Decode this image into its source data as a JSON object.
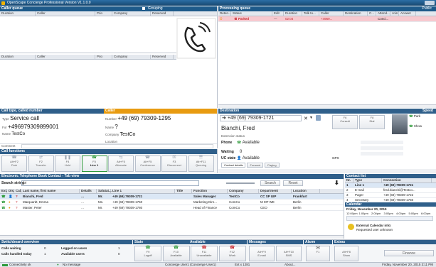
{
  "window": {
    "title": "OpenScape Concierge Professional Version V1.1.0.0"
  },
  "caller_queue": {
    "title": "Caller queue",
    "grouping_label": "Grouping",
    "columns": [
      "Duration",
      "Caller",
      "Prio",
      "Company",
      "Reserved"
    ]
  },
  "processing_queue": {
    "title": "Processing queue",
    "public_label": "Public",
    "columns": [
      "Reten...",
      "Status",
      "Edit",
      "Duration",
      "Talk to...",
      "Caller",
      "Destination",
      "C...",
      "Attend...",
      "Join",
      "Answer"
    ],
    "row": {
      "status": "Parked",
      "edit": "---",
      "duration": "02:04",
      "caller": "+4969...",
      "attend": "Conci..."
    }
  },
  "call_panel": {
    "title": "Call type, called number",
    "caller_title": "Caller",
    "type_label": "Type",
    "type_value": "Service call",
    "number_label": "Number",
    "number_value": "+49 (69) 79309-1295",
    "for_label": "For",
    "for_value": "+496979309899001",
    "name_label": "Name",
    "name_value": "?",
    "name_label2": "Name",
    "name_value2": "TestCo",
    "company_label": "Company",
    "company_value": "TestCo",
    "location_label": "Location",
    "comment_label": "Comment"
  },
  "destination": {
    "title": "Destination",
    "speed_title": "Speed",
    "number": "+49 (69) 79309-1721",
    "name": "Bianchi, Fred",
    "extension_status": "Extension status",
    "phone_label": "Phone",
    "phone_status": "Available",
    "waiting_label": "Waiting",
    "waiting_value": "0",
    "uc_label": "UC state",
    "uc_value": "Available",
    "gps_label": "GPS",
    "btn_consult": "Consult",
    "btn_dial": "Dial",
    "tabs": [
      "Contact details",
      "Forward",
      "Paging"
    ],
    "speed_items": [
      "Park",
      "Show"
    ]
  },
  "call_functions": {
    "title": "Call functions",
    "buttons": [
      {
        "key": "Alt+F2",
        "label": "Park"
      },
      {
        "key": "F2",
        "label": "Transfer"
      },
      {
        "key": "F4",
        "label": "Hold"
      },
      {
        "key": "F5",
        "label": "Line 1"
      },
      {
        "key": "Alt+F5",
        "label": "Alternate"
      },
      {
        "key": "Alt+F5",
        "label": "Conference"
      },
      {
        "key": "F3",
        "label": "Disconnect"
      },
      {
        "key": "Alt+F11",
        "label": "Queuing"
      }
    ]
  },
  "phonebook": {
    "title": "Electronic Telephone Book   Contact - Tab view",
    "search_label": "Search string",
    "search_value": "bi",
    "search_btn": "Search",
    "reset_btn": "Reset",
    "columns": [
      "Ext.",
      "Dis.",
      "Cal.",
      "Last name, first name",
      "Details",
      "Salutat...",
      "Line 1",
      "Title",
      "Function",
      "Company",
      "Department",
      "Location"
    ],
    "rows": [
      {
        "name": "Bianchi, Fred",
        "sal": "Mr.",
        "line": "+49 (69) 79309-1721",
        "func": "Sales Manager",
        "comp": "TestCo",
        "dept": "CC SP UIP",
        "loc": "Frankfurt"
      },
      {
        "name": "Marquardt, Emma",
        "sal": "Ms.",
        "line": "+49 (69) 79309-1750",
        "func": "Marketing Dire...",
        "comp": "ComCo",
        "dept": "M MT WE",
        "loc": "Berlin"
      },
      {
        "name": "Master, Peter",
        "sal": "Mr.",
        "line": "+49 (69) 79309-1780",
        "func": "Head of Finance",
        "comp": "ComCo",
        "dept": "CEO",
        "loc": "Berlin"
      }
    ]
  },
  "contact_list": {
    "title": "Contact list",
    "columns": [
      "Nr.",
      "Type",
      "Connection"
    ],
    "rows": [
      {
        "nr": "1",
        "type": "Line 1",
        "conn": "+49 (69) 79309-1721"
      },
      {
        "nr": "2",
        "type": "E-mail",
        "conn": "fred.bianchi@Testco..."
      },
      {
        "nr": "3",
        "type": "Pager",
        "conn": "+49 (69) 79309-1722"
      },
      {
        "nr": "4",
        "type": "Secretary",
        "conn": "+49 (69) 79309-1750"
      }
    ]
  },
  "calendar": {
    "title": "Calendar",
    "date": "Friday, November 20, 2015",
    "times": [
      "12:00pm",
      "1:00pm",
      "2:00pm",
      "3:00pm",
      "4:00pm",
      "5:00pm",
      "6:00pm"
    ],
    "info_title": "External Calendar info:",
    "info_text": "Requested user unknown"
  },
  "switchboard": {
    "title": "Switchboard overview",
    "calls_waiting_label": "Calls waiting",
    "calls_waiting": "0",
    "logged_users_label": "Logged on users",
    "logged_users": "1",
    "calls_handled_label": "Calls handled today",
    "calls_handled": "1",
    "available_users_label": "Available users",
    "available_users": "0"
  },
  "state": {
    "title": "State",
    "available": "Available",
    "buttons": [
      {
        "key": "F9",
        "label": "Logoff"
      },
      {
        "key": "F10",
        "label": "Available"
      },
      {
        "key": "F11",
        "label": "Unavailable"
      },
      {
        "key": "F12",
        "label": "Work"
      }
    ]
  },
  "messages": {
    "title": "Messages",
    "buttons": [
      {
        "key": "Alt+F9",
        "label": "E-mail"
      },
      {
        "key": "Alt+F10",
        "label": "SMS"
      }
    ]
  },
  "alarm": {
    "title": "Alarm",
    "key": "F1"
  },
  "extras": {
    "title": "Extras",
    "key": "Alt+F8",
    "label": "Show",
    "finance": "Finance"
  },
  "statusbar": {
    "connectivity": "Connectivity ok",
    "message": "No message",
    "user": "Concierge User1 (Concierge User1)",
    "ext": "Ext x 1281",
    "about": "About...",
    "datetime": "Friday, November 20, 2015 3:11 PM"
  }
}
